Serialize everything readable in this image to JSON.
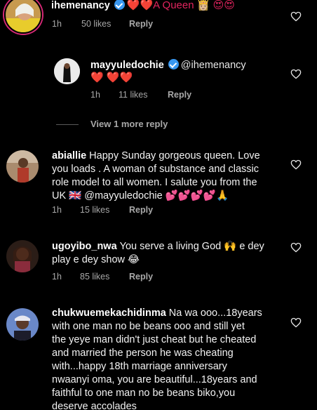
{
  "comments": [
    {
      "username": "ihemenancy",
      "verified": true,
      "text": "❤️❤️A Queen 👸🏼 😍😍",
      "time": "1h",
      "likes": "50 likes",
      "reply": "Reply"
    },
    {
      "username": "mayyuledochie",
      "verified": true,
      "mention": "@ihemenancy",
      "text": "❤️ ❤️❤️",
      "time": "1h",
      "likes": "11 likes",
      "reply": "Reply",
      "view_more": "View 1 more reply"
    },
    {
      "username": "abiallie",
      "text_lines": [
        "Happy Sunday gorgeous queen.  Love",
        "you loads . A woman of substance and classic",
        "role model to all women. I salute you from the",
        "UK 🇬🇧 @mayyuledochie 💕💕💕💕🙏"
      ],
      "time": "1h",
      "likes": "15 likes",
      "reply": "Reply"
    },
    {
      "username": "ugoyibo_nwa",
      "text_lines": [
        "You serve a living God 🙌 e dey",
        "play e dey show 😂"
      ],
      "time": "1h",
      "likes": "85 likes",
      "reply": "Reply"
    },
    {
      "username": "chukwuemekachidinma",
      "text_lines": [
        "Na wa ooo...18years",
        "with one man no be beans ooo and still yet",
        "the yeye man didn't just cheat but he cheated",
        "and married the person he was cheating",
        "with...happy 18th marriage anniversary",
        "nwaanyi oma, you are beautiful...18years and",
        "faithful to one man no be beans biko,you",
        "deserve accolades"
      ]
    }
  ]
}
